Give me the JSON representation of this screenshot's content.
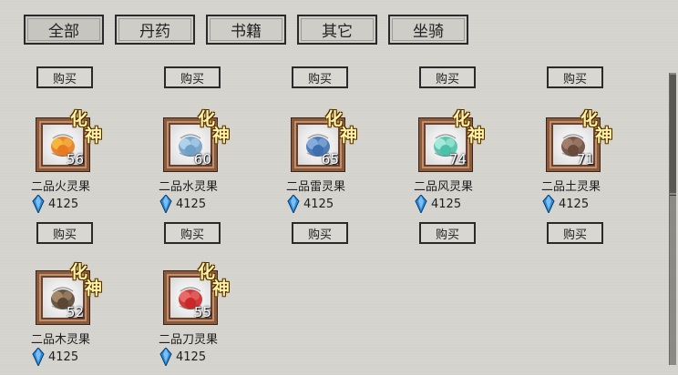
{
  "tabs": [
    {
      "label": "全部"
    },
    {
      "label": "丹药"
    },
    {
      "label": "书籍"
    },
    {
      "label": "其它"
    },
    {
      "label": "坐骑"
    }
  ],
  "buy_label": "购买",
  "rank_chars": [
    "化",
    "神"
  ],
  "items": [
    {
      "name": "二品火灵果",
      "level": "56",
      "price": "4125",
      "fruit_color": "#e87a20",
      "fruit_accent": "#f6c040"
    },
    {
      "name": "二品水灵果",
      "level": "60",
      "price": "4125",
      "fruit_color": "#6fa0c8",
      "fruit_accent": "#b8d8ee"
    },
    {
      "name": "二品雷灵果",
      "level": "65",
      "price": "4125",
      "fruit_color": "#3e6fb0",
      "fruit_accent": "#8fb4e0"
    },
    {
      "name": "二品风灵果",
      "level": "74",
      "price": "4125",
      "fruit_color": "#4fc0a8",
      "fruit_accent": "#aef0e0"
    },
    {
      "name": "二品土灵果",
      "level": "71",
      "price": "4125",
      "fruit_color": "#6a4a3a",
      "fruit_accent": "#a88470"
    },
    {
      "name": "二品木灵果",
      "level": "52",
      "price": "4125",
      "fruit_color": "#5a4632",
      "fruit_accent": "#b09070"
    },
    {
      "name": "二品刀灵果",
      "level": "55",
      "price": "4125",
      "fruit_color": "#c82828",
      "fruit_accent": "#f07070"
    }
  ],
  "colors": {
    "gem": "#2a8ad8",
    "frame": "#8a5a3c",
    "rank_text": "#fff2a6"
  },
  "icons": {
    "currency": "blue-gem-icon"
  }
}
